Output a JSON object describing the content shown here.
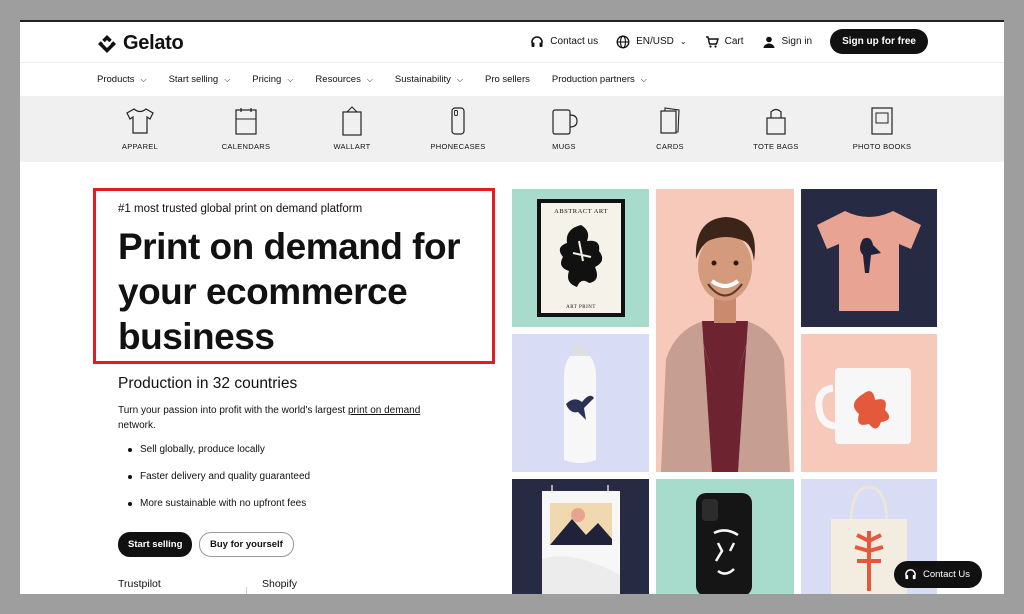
{
  "header": {
    "brand": "Gelato",
    "contact": "Contact us",
    "locale": "EN/USD",
    "cart": "Cart",
    "signin": "Sign in",
    "signup": "Sign up for free"
  },
  "nav": [
    {
      "label": "Products",
      "dropdown": true
    },
    {
      "label": "Start selling",
      "dropdown": true
    },
    {
      "label": "Pricing",
      "dropdown": true
    },
    {
      "label": "Resources",
      "dropdown": true
    },
    {
      "label": "Sustainability",
      "dropdown": true
    },
    {
      "label": "Pro sellers",
      "dropdown": false
    },
    {
      "label": "Production partners",
      "dropdown": true
    }
  ],
  "categories": [
    {
      "label": "APPAREL",
      "icon": "tshirt-icon"
    },
    {
      "label": "CALENDARS",
      "icon": "calendar-icon"
    },
    {
      "label": "WALLART",
      "icon": "wallart-icon"
    },
    {
      "label": "PHONECASES",
      "icon": "phonecase-icon"
    },
    {
      "label": "MUGS",
      "icon": "mug-icon"
    },
    {
      "label": "CARDS",
      "icon": "cards-icon"
    },
    {
      "label": "TOTE BAGS",
      "icon": "tote-bag-icon"
    },
    {
      "label": "PHOTO BOOKS",
      "icon": "photo-book-icon"
    }
  ],
  "hero": {
    "eyebrow": "#1 most trusted global print on demand platform",
    "title": "Print on demand for your ecommerce business",
    "subtitle": "Production in 32 countries",
    "desc_pre": "Turn your passion into profit with the world's largest ",
    "desc_link": "print on demand",
    "desc_post": " network.",
    "bullets": [
      "Sell globally, produce locally",
      "Faster delivery and quality guaranteed",
      "More sustainable with no upfront fees"
    ],
    "cta_primary": "Start selling",
    "cta_secondary": "Buy for yourself",
    "review_1": "Trustpilot",
    "review_2": "Shopify"
  },
  "gallery": {
    "poster_title": "ABSTRACT ART",
    "poster_caption": "ART PRINT"
  },
  "chat": {
    "label": "Contact Us"
  },
  "colors": {
    "highlight": "#e31b23",
    "mint": "#a7dccd",
    "peach": "#f6c9bb",
    "lavender": "#d9dcf5",
    "navy": "#272a43"
  }
}
